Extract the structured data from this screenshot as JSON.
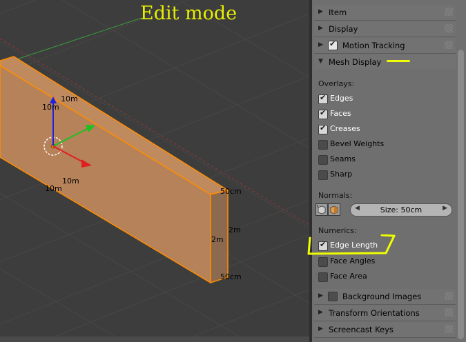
{
  "viewport": {
    "title": "Edit mode",
    "dims": {
      "top_10m": "10m",
      "top_10m_b": "10m",
      "mid_10m": "10m",
      "left_10m": "10m",
      "top_50cm": "50cm",
      "right_2m": "2m",
      "left_2m": "2m",
      "bottom_50cm": "50cm"
    }
  },
  "panel": {
    "sections": {
      "item": "Item",
      "display": "Display",
      "motion_tracking": "Motion Tracking",
      "mesh_display": "Mesh Display"
    },
    "overlays_label": "Overlays:",
    "overlays": [
      {
        "label": "Edges",
        "checked": true
      },
      {
        "label": "Faces",
        "checked": true
      },
      {
        "label": "Creases",
        "checked": true
      },
      {
        "label": "Bevel Weights",
        "checked": false
      },
      {
        "label": "Seams",
        "checked": false
      },
      {
        "label": "Sharp",
        "checked": false
      }
    ],
    "normals_label": "Normals:",
    "normals_size": "Size: 50cm",
    "numerics_label": "Numerics:",
    "numerics": [
      {
        "label": "Edge Length",
        "checked": true
      },
      {
        "label": "Face Angles",
        "checked": false
      },
      {
        "label": "Face Area",
        "checked": false
      }
    ],
    "bottom_sections": {
      "background_images": "Background Images",
      "transform_orientations": "Transform Orientations",
      "screencast_keys": "Screencast Keys"
    }
  },
  "colors": {
    "annotation": "#f0ff00",
    "selection": "#ff8c00",
    "mesh_face": "#b5825a"
  }
}
